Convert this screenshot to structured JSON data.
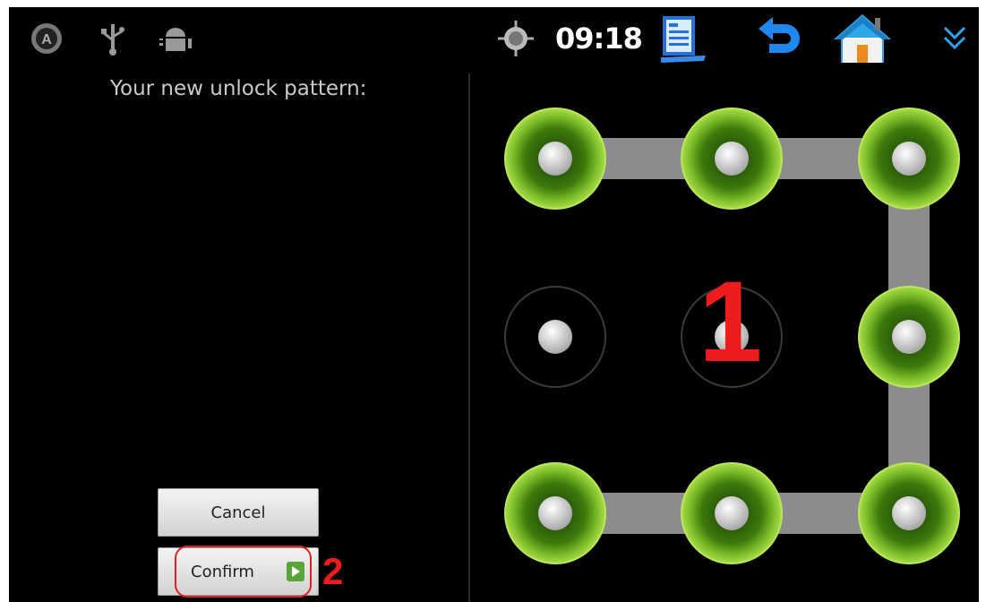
{
  "status_bar": {
    "time": "09:18",
    "icons": [
      "accessibility-icon",
      "usb-icon",
      "android-debug-icon",
      "gps-icon",
      "notes-icon",
      "back-icon",
      "home-icon",
      "collapse-icon"
    ]
  },
  "pattern_screen": {
    "prompt": "Your new unlock pattern:",
    "cancel_label": "Cancel",
    "confirm_label": "Confirm"
  },
  "pattern": {
    "grid": [
      "top-left",
      "top-center",
      "top-right",
      "middle-left",
      "middle-center",
      "middle-right",
      "bottom-left",
      "bottom-center",
      "bottom-right"
    ],
    "selected": [
      0,
      1,
      2,
      5,
      8,
      7,
      6
    ]
  },
  "annotations": {
    "step1": "1",
    "step2": "2"
  },
  "colors": {
    "background": "#000000",
    "dot_active": "#7fbf2a",
    "path": "#8c8c8c",
    "annotation": "#ee1c1c"
  }
}
